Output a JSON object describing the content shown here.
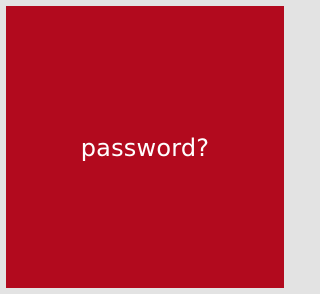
{
  "tile": {
    "label": "password?",
    "background_color": "#b20a1e",
    "text_color": "#ffffff"
  },
  "page": {
    "background_color": "#e3e3e3"
  }
}
